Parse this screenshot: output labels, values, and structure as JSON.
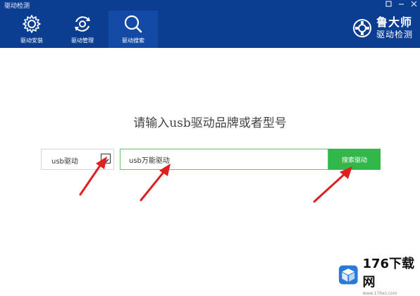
{
  "window": {
    "title": "驱动检测",
    "controls": [
      "square-icon",
      "minimize-icon",
      "close-icon"
    ]
  },
  "tabs": [
    {
      "label": "驱动安装",
      "icon": "gear-icon",
      "active": false
    },
    {
      "label": "驱动管理",
      "icon": "refresh-gear-icon",
      "active": false
    },
    {
      "label": "驱动搜索",
      "icon": "search-icon",
      "active": true
    }
  ],
  "logo": {
    "main": "鲁大师",
    "sub": "驱动检测"
  },
  "search": {
    "prompt": "请输入usb驱动品牌或者型号",
    "brand_value": "usb驱动",
    "input_value": "usb万能驱动",
    "button_label": "搜索驱动"
  },
  "watermark": {
    "text": "176下载网",
    "sub": "www.176xz.com"
  },
  "colors": {
    "header": "#0b3d91",
    "active_tab": "#134aa6",
    "button": "#32b74b",
    "annotation_arrow": "#e02020"
  }
}
